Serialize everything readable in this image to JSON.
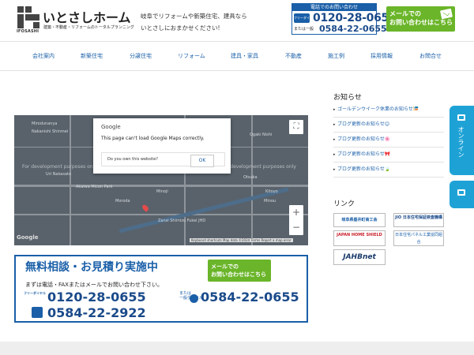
{
  "header": {
    "logo_abbr": "IFOSASHI",
    "logo_name": "いとさしホーム",
    "logo_tagline": "建築・不動産・リフォームのトータルプランニング",
    "intro_line1": "岐阜でリフォームや新築住宅、建具なら",
    "intro_line2": "いとさしにおまかせください!",
    "phone_label": "電話でのお問い合わせ",
    "free_dial_label": "フリーダイヤル",
    "free_dial": "0120-28-0655",
    "or_label": "または一般",
    "general_phone": "0584-22-0655",
    "mail_button_line1": "メールでの",
    "mail_button_line2": "お問い合わせはこちら"
  },
  "nav": {
    "items": [
      "会社案内",
      "新築住宅",
      "分譲住宅",
      "リフォーム",
      "建具・家具",
      "不動産",
      "施工例",
      "採用情報",
      "お問合せ"
    ]
  },
  "map": {
    "google_label": "Google",
    "error_message": "This page can't load Google Maps correctly.",
    "own_question": "Do you own this website?",
    "ok_label": "OK",
    "dev_notice_left": "For development purposes only",
    "dev_notice_right": "For development purposes only",
    "fullscreen_symbol": "⛶",
    "zoom_in": "+",
    "zoom_out": "−",
    "footer_text": "Keyboard shortcuts   Map data ©2024   Terms   Report a map error",
    "places": [
      "Mirodunanya",
      "Nakanishi Shinmei",
      "Ogaki Nishi",
      "Uri Nakasato",
      "Akaiwa Micon Park",
      "Otsuka",
      "Minoji",
      "Zansi Shimizu Fukei JHD",
      "Kitoyo",
      "Minou",
      "Moroda"
    ]
  },
  "banner": {
    "title": "無料相談・お見積り実施中",
    "subtitle": "まずは電話・FAXまたはメールでお問い合わせ下さい。",
    "mail_line1": "メールでの",
    "mail_line2": "お問い合わせはこちら",
    "free_tag": "フリーダイヤル",
    "free_dial": "0120-28-0655",
    "or_tag_line1": "または",
    "or_tag_line2": "一般ダイヤル",
    "general_phone": "0584-22-0655",
    "fax": "0584-22-2922"
  },
  "sidebar": {
    "news_title": "お知らせ",
    "news": [
      "ゴールデンウイーク休業のお知らせ🎏",
      "ブログ更新のお知らせ😊",
      "ブログ更新のお知らせ🌸",
      "ブログ更新のお知らせ🎀",
      "ブログ更新のお知らせ🍃"
    ],
    "link_title": "リンク",
    "links": [
      "岐阜県垂井町商工会",
      "JIO 日本住宅保証検査機構",
      "JAPAN HOME SHIELD",
      "日本住宅パネル工業協同組合",
      "JAHBnet"
    ]
  },
  "floating": {
    "online_tab": "オンライン",
    "second_tab": "モデル"
  }
}
